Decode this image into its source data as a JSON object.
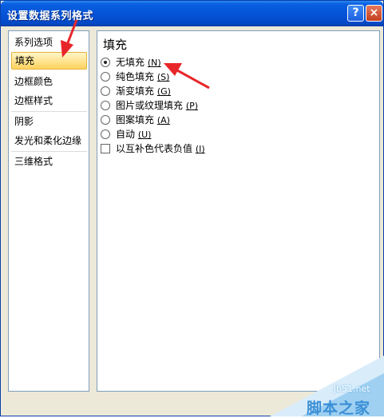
{
  "window": {
    "title": "设置数据系列格式",
    "help_label": "?",
    "close_label": "×"
  },
  "nav": {
    "items": [
      {
        "label": "系列选项"
      },
      {
        "label": "填充"
      },
      {
        "label": "边框颜色"
      },
      {
        "label": "边框样式"
      },
      {
        "label": "阴影"
      },
      {
        "label": "发光和柔化边缘"
      },
      {
        "label": "三维格式"
      }
    ],
    "selected": "填充"
  },
  "fill": {
    "title": "填充",
    "options": [
      {
        "label": "无填充",
        "key": "(N)",
        "selected": true
      },
      {
        "label": "纯色填充",
        "key": "(S)",
        "selected": false
      },
      {
        "label": "渐变填充",
        "key": "(G)",
        "selected": false
      },
      {
        "label": "图片或纹理填充",
        "key": "(P)",
        "selected": false
      },
      {
        "label": "图案填充",
        "key": "(A)",
        "selected": false
      },
      {
        "label": "自动",
        "key": "(U)",
        "selected": false
      }
    ],
    "invert": {
      "label": "以互补色代表负值",
      "key": "(I)",
      "checked": false
    }
  },
  "watermark": {
    "domain": "jb51.net",
    "name": "脚本之家"
  },
  "colors": {
    "title_bar": "#0554d8",
    "selected_item": "#ffd35f",
    "annotation_arrow": "#e8262a",
    "watermark": "#3a8fd6"
  }
}
